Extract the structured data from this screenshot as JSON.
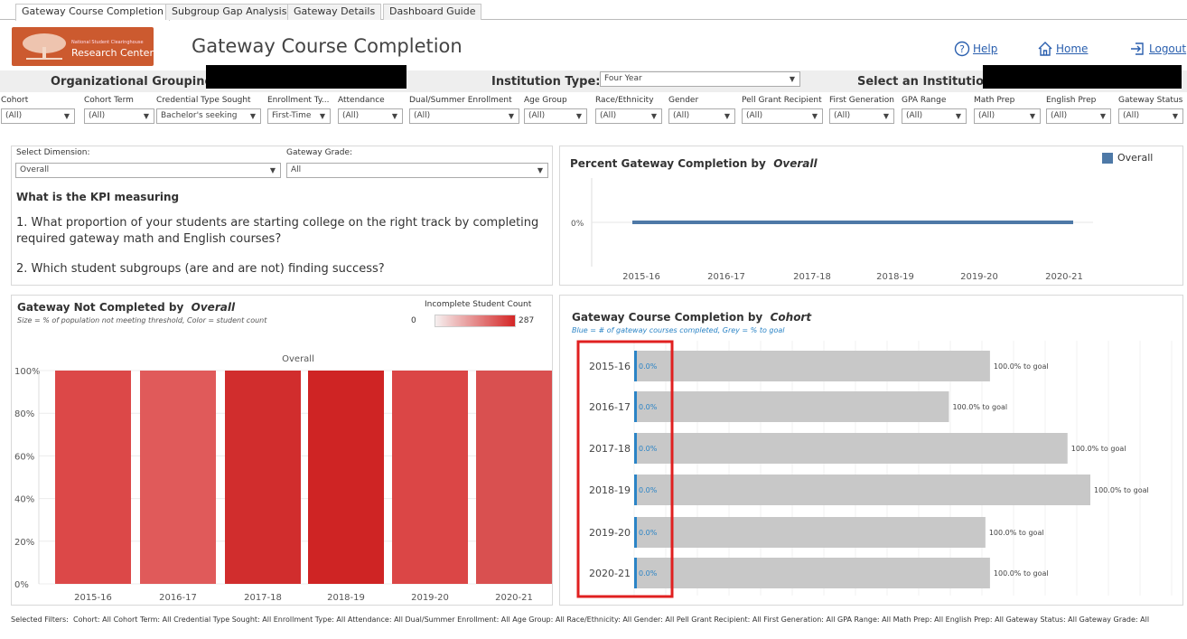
{
  "tabs": [
    "Gateway Course Completion",
    "Subgroup Gap Analysis",
    "Gateway Details",
    "Dashboard Guide"
  ],
  "header": {
    "logo_small": "National Student Clearinghouse",
    "logo_big": "Research Center",
    "title": "Gateway Course Completion",
    "help": "Help",
    "home": "Home",
    "logout": "Logout"
  },
  "org": {
    "org_label": "Organizational Grouping:",
    "inst_type_label": "Institution Type:",
    "inst_type_value": "Four Year",
    "select_inst_label": "Select an Institution:"
  },
  "filters": [
    {
      "label": "Cohort",
      "value": "(All)"
    },
    {
      "label": "Cohort Term",
      "value": "(All)"
    },
    {
      "label": "Credential Type Sought",
      "value": "Bachelor's seeking"
    },
    {
      "label": "Enrollment Ty...",
      "value": "First-Time"
    },
    {
      "label": "Attendance",
      "value": "(All)"
    },
    {
      "label": "Dual/Summer Enrollment",
      "value": "(All)"
    },
    {
      "label": "Age Group",
      "value": "(All)"
    },
    {
      "label": "Race/Ethnicity",
      "value": "(All)"
    },
    {
      "label": "Gender",
      "value": "(All)"
    },
    {
      "label": "Pell Grant Recipient",
      "value": "(All)"
    },
    {
      "label": "First Generation",
      "value": "(All)"
    },
    {
      "label": "GPA Range",
      "value": "(All)"
    },
    {
      "label": "Math Prep",
      "value": "(All)"
    },
    {
      "label": "English Prep",
      "value": "(All)"
    },
    {
      "label": "Gateway Status",
      "value": "(All)"
    }
  ],
  "kpi": {
    "select_dimension_label": "Select Dimension:",
    "select_dimension_value": "Overall",
    "gateway_grade_label": "Gateway Grade:",
    "gateway_grade_value": "All",
    "heading": "What is the KPI measuring",
    "q1": "1. What proportion of your students are starting college on the right track by completing required gateway math and English courses?",
    "q2": "2. Which student subgroups (are and are not) finding success?"
  },
  "line_panel": {
    "title_prefix": "Percent Gateway Completion by",
    "title_dim": "Overall",
    "legend": "Overall",
    "y_tick": "0%"
  },
  "bar_panel": {
    "title_prefix": "Gateway Not Completed by",
    "title_dim": "Overall",
    "subtitle": "Size = % of population not meeting threshold,  Color = student count",
    "legend_title": "Incomplete Student Count",
    "legend_min": "0",
    "legend_max": "287",
    "facet": "Overall"
  },
  "hbar_panel": {
    "title_prefix": "Gateway Course Completion by",
    "title_dim": "Cohort",
    "subtitle": "Blue = # of gateway courses completed, Grey = % to goal"
  },
  "chart_data": [
    {
      "type": "line",
      "title": "Percent Gateway Completion by Overall",
      "x": [
        "2015-16",
        "2016-17",
        "2017-18",
        "2018-19",
        "2019-20",
        "2020-21"
      ],
      "series": [
        {
          "name": "Overall",
          "values": [
            0,
            0,
            0,
            0,
            0,
            0
          ],
          "color": "#4e79a7"
        }
      ],
      "yticks": [
        "0%"
      ]
    },
    {
      "type": "bar",
      "title": "Gateway Not Completed by Overall",
      "categories": [
        "2015-16",
        "2016-17",
        "2017-18",
        "2018-19",
        "2019-20",
        "2020-21"
      ],
      "values": [
        100,
        100,
        100,
        100,
        100,
        100
      ],
      "colors": [
        "#dc4848",
        "#e05a5a",
        "#d12d2d",
        "#cf2424",
        "#db4646",
        "#d95050"
      ],
      "yticks": [
        "0%",
        "20%",
        "40%",
        "60%",
        "80%",
        "100%"
      ],
      "ylim": [
        0,
        100
      ]
    },
    {
      "type": "bar",
      "orientation": "horizontal",
      "title": "Gateway Course Completion by Cohort",
      "categories": [
        "2015-16",
        "2016-17",
        "2017-18",
        "2018-19",
        "2019-20",
        "2020-21"
      ],
      "completed_labels": [
        "0.0%",
        "0.0%",
        "0.0%",
        "0.0%",
        "0.0%",
        "0.0%"
      ],
      "goal_labels": [
        "100.0% to goal",
        "100.0% to goal",
        "100.0% to goal",
        "100.0% to goal",
        "100.0% to goal",
        "100.0% to goal"
      ],
      "relative_values": [
        0.78,
        0.69,
        0.95,
        1.0,
        0.77,
        0.78
      ]
    }
  ],
  "footer": {
    "prefix": "Selected Filters:",
    "text": "Cohort: All   Cohort Term: All   Credential Type Sought: All   Enrollment Type: All   Attendance: All   Dual/Summer Enrollment: All   Age Group: All   Race/Ethnicity: All   Gender: All   Pell Grant Recipient: All   First Generation: All   GPA Range: All   Math Prep: All   English Prep: All   Gateway Status: All   Gateway Grade: All"
  }
}
